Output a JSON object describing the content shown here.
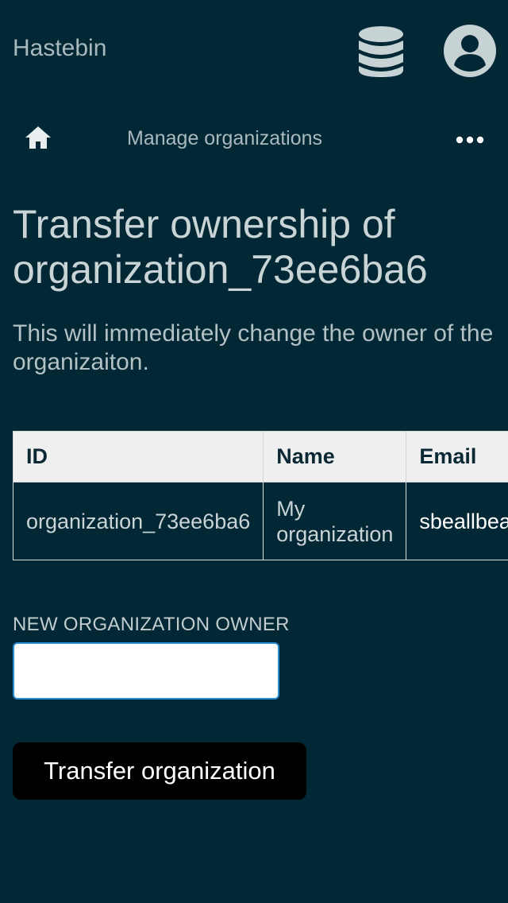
{
  "header": {
    "brand": "Hastebin",
    "database_icon": "database-icon",
    "account_icon": "user-circle-icon"
  },
  "nav": {
    "home_icon": "home-icon",
    "breadcrumb": "Manage organizations",
    "more_icon": "more-horizontal-icon"
  },
  "main": {
    "title": "Transfer ownership of organization_73ee6ba6",
    "description": "This will immediately change the owner of the organizaiton."
  },
  "table": {
    "headers": [
      "ID",
      "Name",
      "Email"
    ],
    "rows": [
      [
        "organization_73ee6ba6",
        "My organization",
        "sbeallbeall"
      ]
    ]
  },
  "form": {
    "owner_label": "NEW ORGANIZATION OWNER",
    "owner_value": "",
    "owner_placeholder": "",
    "submit_label": "Transfer organization"
  },
  "colors": {
    "background": "#032835",
    "text": "#c9d4d6",
    "header_row": "#efefef",
    "input_focus": "#2a8fd6",
    "button": "#000000"
  }
}
